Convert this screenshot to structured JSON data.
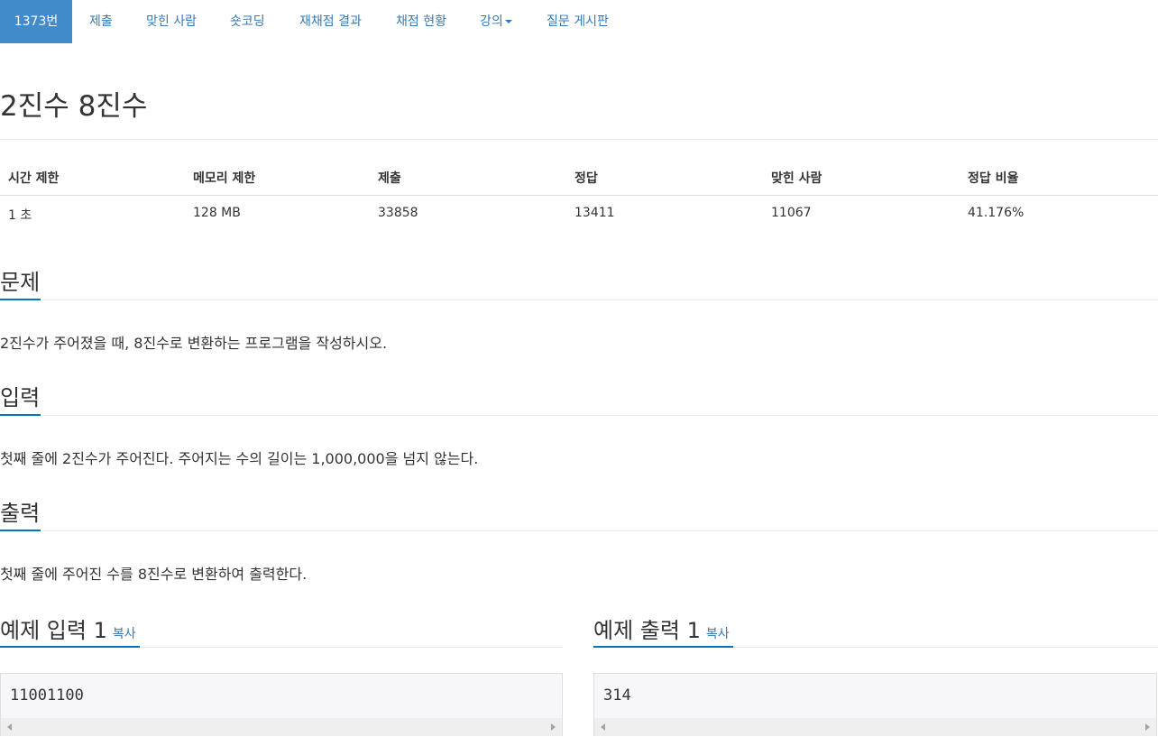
{
  "nav": {
    "items": [
      {
        "label": "1373번",
        "active": true
      },
      {
        "label": "제출"
      },
      {
        "label": "맞힌 사람"
      },
      {
        "label": "숏코딩"
      },
      {
        "label": "재채점 결과"
      },
      {
        "label": "채점 현황"
      },
      {
        "label": "강의",
        "dropdown": true
      },
      {
        "label": "질문 게시판"
      }
    ]
  },
  "problem": {
    "title": "2진수 8진수"
  },
  "info_table": {
    "headers": [
      "시간 제한",
      "메모리 제한",
      "제출",
      "정답",
      "맞힌 사람",
      "정답 비율"
    ],
    "values": [
      "1 초",
      "128 MB",
      "33858",
      "13411",
      "11067",
      "41.176%"
    ]
  },
  "sections": {
    "problem": {
      "heading": "문제",
      "text": "2진수가 주어졌을 때, 8진수로 변환하는 프로그램을 작성하시오."
    },
    "input": {
      "heading": "입력",
      "text": "첫째 줄에 2진수가 주어진다. 주어지는 수의 길이는 1,000,000을 넘지 않는다."
    },
    "output": {
      "heading": "출력",
      "text": "첫째 줄에 주어진 수를 8진수로 변환하여 출력한다."
    }
  },
  "samples": {
    "input": {
      "heading": "예제 입력 1",
      "copy_label": "복사",
      "content": "11001100"
    },
    "output": {
      "heading": "예제 출력 1",
      "copy_label": "복사",
      "content": "314"
    }
  },
  "colors": {
    "accent": "#428bca",
    "link": "#337ab7",
    "section_underline": "#0076c0"
  }
}
